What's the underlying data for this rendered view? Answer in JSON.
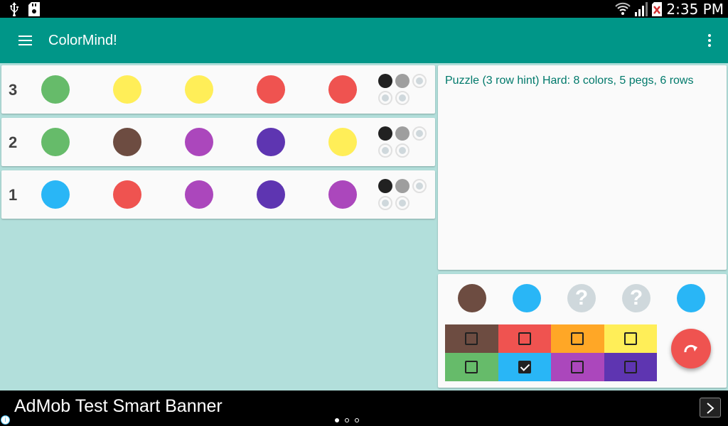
{
  "status_bar": {
    "time": "2:35 PM"
  },
  "app_bar": {
    "title": "ColorMind!"
  },
  "colors": {
    "brown": "#6d4c41",
    "red": "#ef5350",
    "orange": "#ffa726",
    "yellow": "#ffee58",
    "green": "#66bb6a",
    "blue": "#29b6f6",
    "purple": "#ab47bc",
    "indigo": "#5e35b1",
    "appbar": "#009688",
    "background": "#b2dfdb"
  },
  "guess_rows": [
    {
      "number": "3",
      "pegs": [
        "green",
        "yellow",
        "yellow",
        "red",
        "red"
      ],
      "hints": [
        "black",
        "gray",
        "empty",
        "empty",
        "empty"
      ]
    },
    {
      "number": "2",
      "pegs": [
        "green",
        "brown",
        "purple",
        "indigo",
        "yellow"
      ],
      "hints": [
        "black",
        "gray",
        "empty",
        "empty",
        "empty"
      ]
    },
    {
      "number": "1",
      "pegs": [
        "blue",
        "red",
        "purple",
        "indigo",
        "purple"
      ],
      "hints": [
        "black",
        "gray",
        "empty",
        "empty",
        "empty"
      ]
    }
  ],
  "info": {
    "puzzle_text": "Puzzle (3 row hint) Hard: 8 colors, 5 pegs, 6 rows"
  },
  "current_guess": {
    "pegs": [
      "brown",
      "blue",
      "unknown",
      "unknown",
      "blue"
    ],
    "unknown_symbol": "?"
  },
  "palette": [
    {
      "color": "brown",
      "checked": false
    },
    {
      "color": "red",
      "checked": false
    },
    {
      "color": "orange",
      "checked": false
    },
    {
      "color": "yellow",
      "checked": false
    },
    {
      "color": "green",
      "checked": false
    },
    {
      "color": "blue",
      "checked": true
    },
    {
      "color": "purple",
      "checked": false
    },
    {
      "color": "indigo",
      "checked": false
    }
  ],
  "fab": {
    "icon": "redo-icon"
  },
  "ad": {
    "text": "AdMob Test Smart Banner",
    "info_symbol": "i"
  }
}
